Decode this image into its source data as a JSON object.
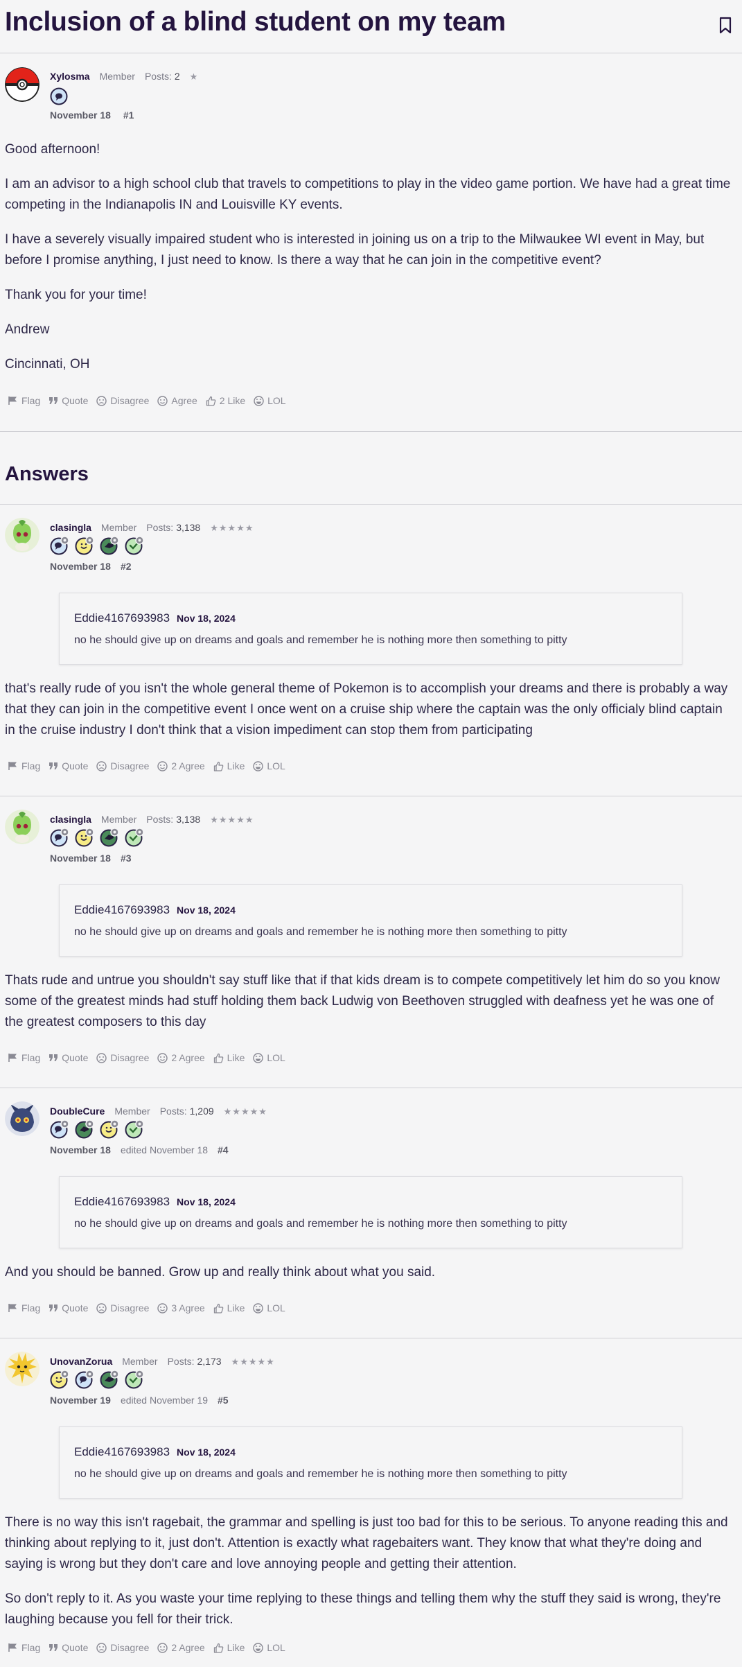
{
  "thread": {
    "title": "Inclusion of a blind student on my team"
  },
  "answers_heading": "Answers",
  "reaction_labels": {
    "flag": "Flag",
    "quote": "Quote",
    "disagree": "Disagree",
    "agree": "Agree",
    "like": "Like",
    "lol": "LOL"
  },
  "op": {
    "author": "Xylosma",
    "role": "Member",
    "posts_label": "Posts:",
    "posts": "2",
    "stars": "★",
    "date": "November 18",
    "num": "#1",
    "paragraphs": [
      "Good afternoon!",
      "I am an advisor to a high school club that travels to competitions to play in the video game portion. We have had a great time competing in the Indianapolis IN and Louisville KY events.",
      "I have a severely visually impaired student who is interested in joining us on a trip to the Milwaukee WI event in May, but before I promise anything, I just need to know. Is there a way that he can join in the competitive event?",
      "Thank you for your time!",
      "Andrew",
      "Cincinnati, OH"
    ],
    "like_label": "2 Like"
  },
  "quote": {
    "author": "Eddie4167693983",
    "date": "Nov 18, 2024",
    "text": "no he should give up on dreams and goals and remember he is nothing more then something to pitty"
  },
  "answers": [
    {
      "author": "clasingla",
      "role": "Member",
      "posts_label": "Posts:",
      "posts": "3,138",
      "stars": "★★★★★",
      "date": "November 18",
      "edited": "",
      "num": "#2",
      "paragraphs": [
        "that's really rude of you isn't the whole general theme of Pokemon is to accomplish your dreams and there is probably a way that they can join in the competitive event I once went on a cruise ship where the captain was the only officialy blind captain in the cruise industry I don't think that a vision impediment can stop them from participating"
      ],
      "agree_label": "2 Agree"
    },
    {
      "author": "clasingla",
      "role": "Member",
      "posts_label": "Posts:",
      "posts": "3,138",
      "stars": "★★★★★",
      "date": "November 18",
      "edited": "",
      "num": "#3",
      "paragraphs": [
        "Thats rude and untrue you shouldn't say stuff like that if that kids dream is to compete competitively let him do so you know some of the greatest minds had stuff holding them back Ludwig von Beethoven struggled with deafness yet he was one of the greatest composers to this day"
      ],
      "agree_label": "2 Agree"
    },
    {
      "author": "DoubleCure",
      "role": "Member",
      "posts_label": "Posts:",
      "posts": "1,209",
      "stars": "★★★★★",
      "date": "November 18",
      "edited": "edited November 18",
      "num": "#4",
      "paragraphs": [
        "And you should be banned. Grow up and really think about what you said."
      ],
      "agree_label": "3 Agree"
    },
    {
      "author": "UnovanZorua",
      "role": "Member",
      "posts_label": "Posts:",
      "posts": "2,173",
      "stars": "★★★★★",
      "date": "November 19",
      "edited": "edited November 19",
      "num": "#5",
      "paragraphs": [
        "There is no way this isn't ragebait, the grammar and spelling is just too bad for this to be serious. To anyone reading this and thinking about replying to it, just don't. Attention is exactly what ragebaiters want. They know that what they're doing and saying is wrong but they don't care and love annoying people and getting their attention.",
        "So don't reply to it. As you waste your time replying to these things and telling them why the stuff they said is wrong, they're laughing because you fell for their trick."
      ],
      "agree_label": "2 Agree"
    }
  ],
  "colors": {
    "title": "#24143f",
    "text": "#2e2848",
    "muted": "#7a7a86",
    "background": "#f5f5f6",
    "divider": "#cfcfd4"
  },
  "icons": [
    "bookmark-icon",
    "flag-icon",
    "quote-icon",
    "disagree-icon",
    "agree-icon",
    "like-icon",
    "lol-icon",
    "member-badge-icon"
  ]
}
